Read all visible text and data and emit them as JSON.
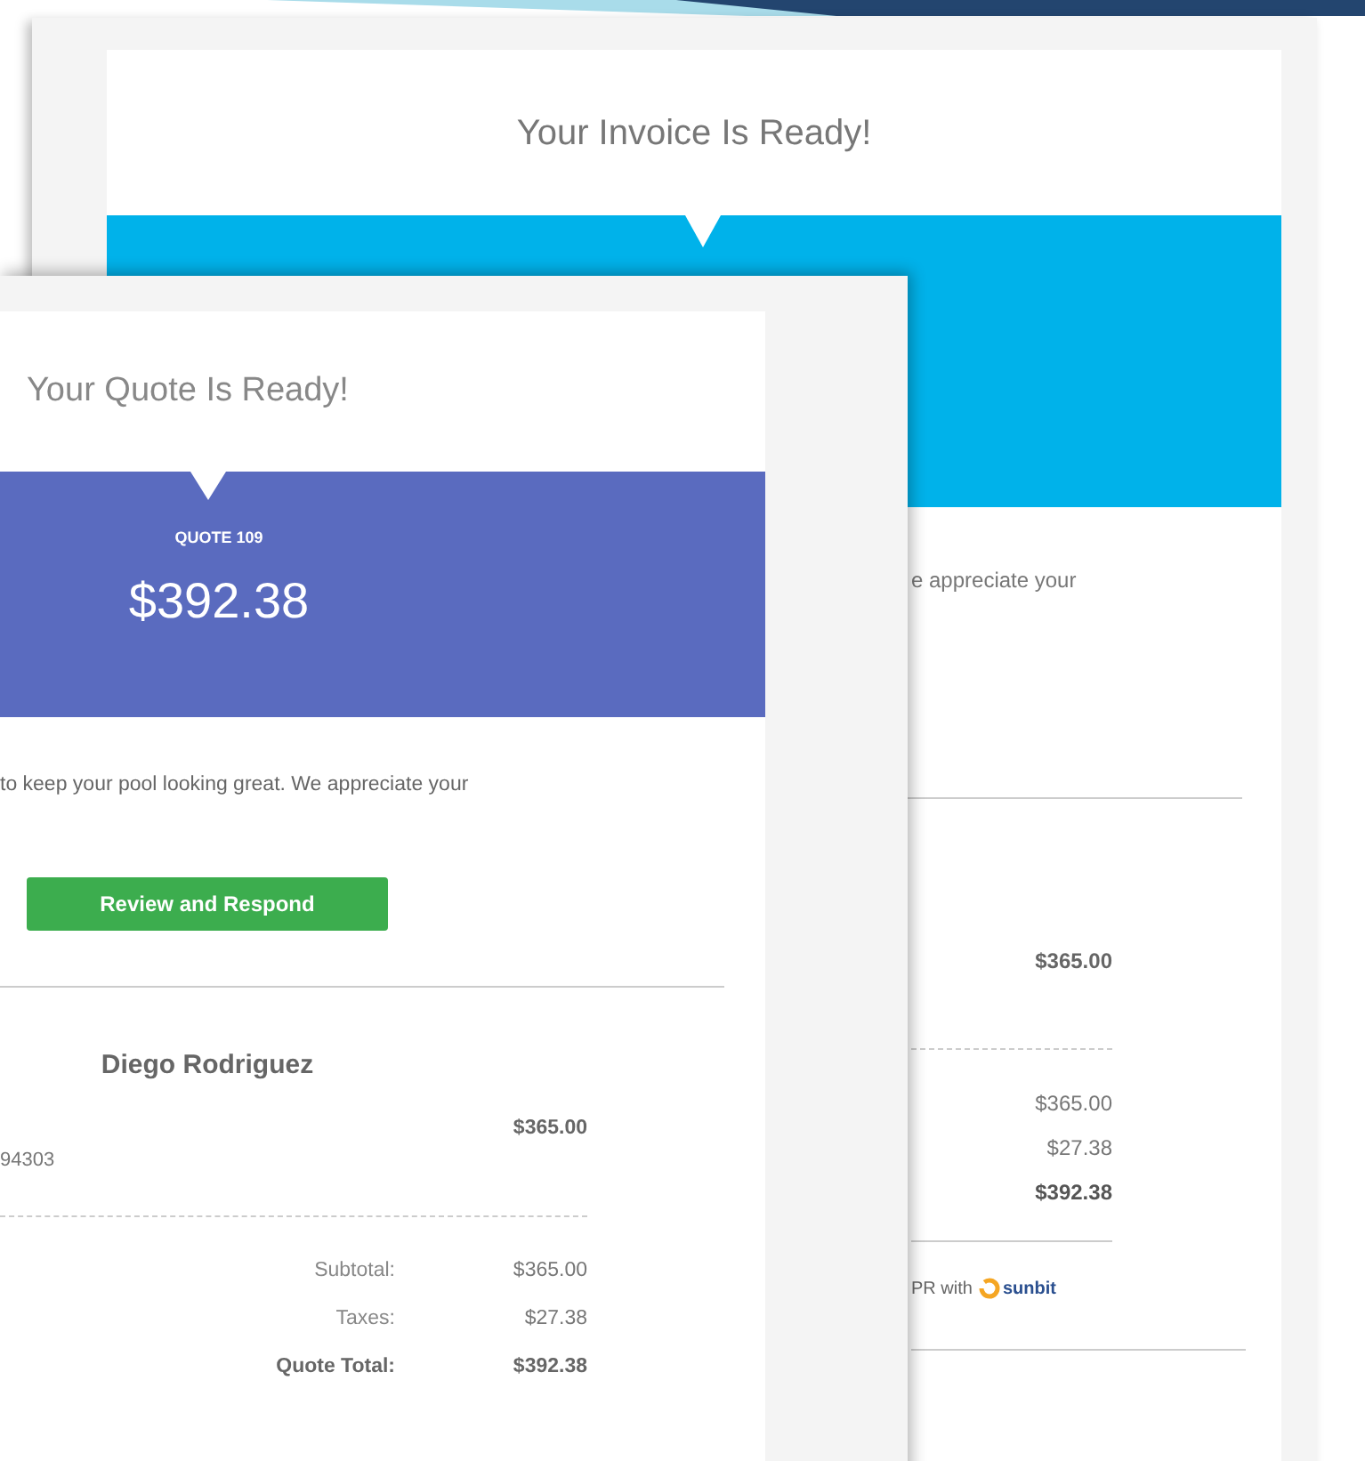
{
  "invoice_email": {
    "title": "Your Invoice Is Ready!",
    "intro_text": "e appreciate your",
    "line_item": {
      "amount": "$365.00"
    },
    "totals": [
      {
        "value": "$365.00",
        "emphasis": false
      },
      {
        "value": "$27.38",
        "emphasis": false
      },
      {
        "value": "$392.38",
        "emphasis": true
      }
    ],
    "financing": {
      "text": "PR with",
      "logo_text": "sunbit"
    }
  },
  "quote_email": {
    "title": "Your Quote Is Ready!",
    "quote_label": "QUOTE 109",
    "amount": "$392.38",
    "intro_text": "to keep your pool looking great. We appreciate your",
    "button": "Review and Respond",
    "customer_name": "Diego Rodriguez",
    "line_item": {
      "detail": "94303",
      "amount": "$365.00"
    },
    "totals": [
      {
        "label": "Subtotal:",
        "value": "$365.00",
        "emphasis": false
      },
      {
        "label": "Taxes:",
        "value": "$27.38",
        "emphasis": false
      },
      {
        "label": "Quote Total:",
        "value": "$392.38",
        "emphasis": true
      }
    ]
  }
}
